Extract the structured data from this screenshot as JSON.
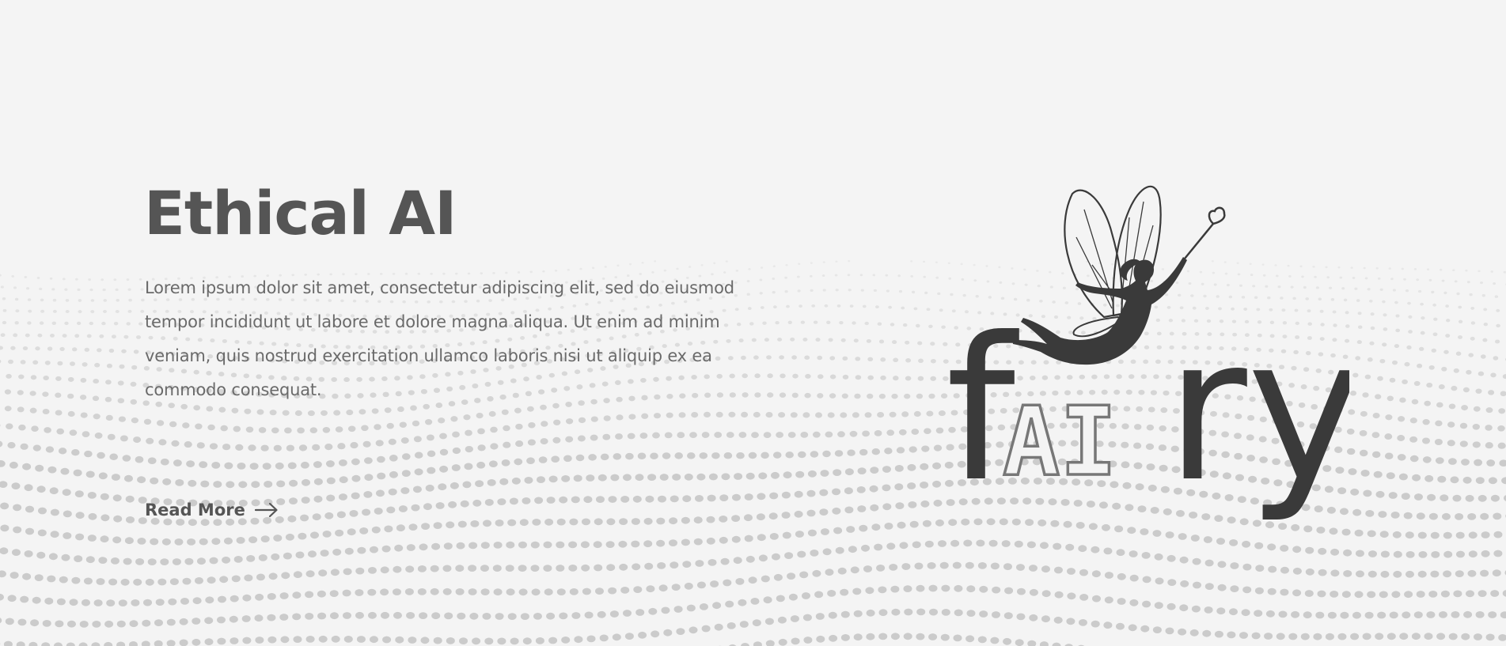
{
  "hero": {
    "title": "Ethical AI",
    "body": "Lorem ipsum dolor sit amet, consectetur adipiscing elit, sed do eiusmod tempor incididunt ut labore et dolore magna aliqua. Ut enim ad minim veniam, quis nostrud exercitation ullamco laboris nisi ut aliquip ex ea commodo consequat.",
    "read_more_label": "Read More",
    "arrow_icon": "arrow-right-icon"
  },
  "logo": {
    "text_f": "f",
    "text_ai": "AI",
    "text_ry": "ry",
    "figure_icon": "fairy-icon"
  },
  "colors": {
    "background": "#f4f4f4",
    "heading": "#555555",
    "body_text": "#6a6a6a",
    "logo_dark": "#3a3a3a",
    "logo_outline": "#777777",
    "dots": "#c8c8c8"
  }
}
